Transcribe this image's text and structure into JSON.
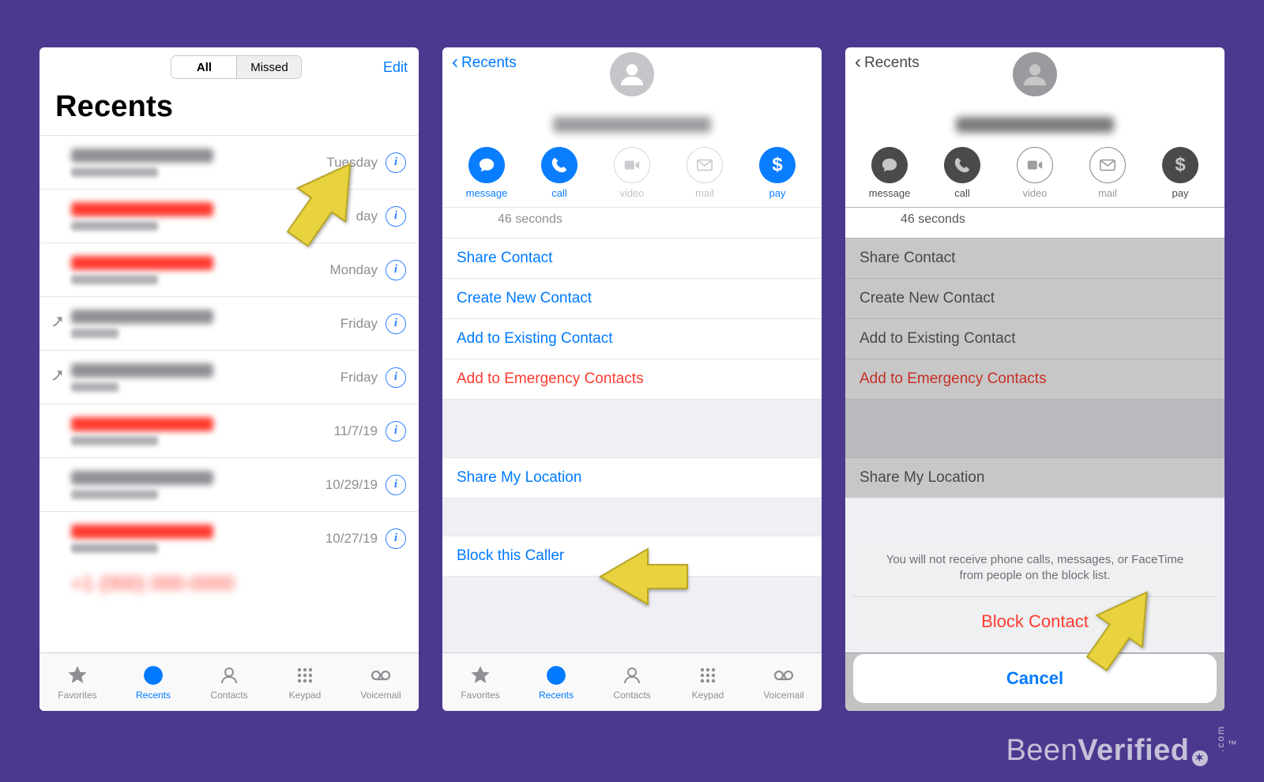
{
  "colors": {
    "ios_blue": "#007aff",
    "ios_red": "#ff3b30",
    "bg_purple": "#4c388f",
    "arrow": "#e4cf3a"
  },
  "watermark": {
    "brand_a": "Been",
    "brand_b": "Verified",
    "suffix": ".com",
    "tm": "™"
  },
  "phone1": {
    "segments": {
      "all": "All",
      "missed": "Missed"
    },
    "edit": "Edit",
    "title": "Recents",
    "rows": [
      {
        "missed": false,
        "outgoing": false,
        "date": "Tuesday"
      },
      {
        "missed": true,
        "outgoing": false,
        "date": "day"
      },
      {
        "missed": true,
        "outgoing": false,
        "date": "Monday"
      },
      {
        "missed": false,
        "outgoing": true,
        "date": "Friday"
      },
      {
        "missed": false,
        "outgoing": true,
        "date": "Friday"
      },
      {
        "missed": true,
        "outgoing": false,
        "date": "11/7/19"
      },
      {
        "missed": false,
        "outgoing": false,
        "date": "10/29/19"
      },
      {
        "missed": true,
        "outgoing": false,
        "date": "10/27/19"
      }
    ],
    "info_glyph": "i"
  },
  "contact": {
    "back": "Recents",
    "actions": {
      "message": "message",
      "call": "call",
      "video": "video",
      "mail": "mail",
      "pay": "pay"
    },
    "duration": "46 seconds",
    "share_contact": "Share Contact",
    "create_new": "Create New Contact",
    "add_existing": "Add to Existing Contact",
    "add_emergency": "Add to Emergency Contacts",
    "share_location": "Share My Location",
    "block": "Block this Caller"
  },
  "sheet": {
    "message": "You will not receive phone calls, messages, or FaceTime from people on the block list.",
    "block": "Block Contact",
    "cancel": "Cancel"
  },
  "tabs": {
    "favorites": "Favorites",
    "recents": "Recents",
    "contacts": "Contacts",
    "keypad": "Keypad",
    "voicemail": "Voicemail"
  }
}
